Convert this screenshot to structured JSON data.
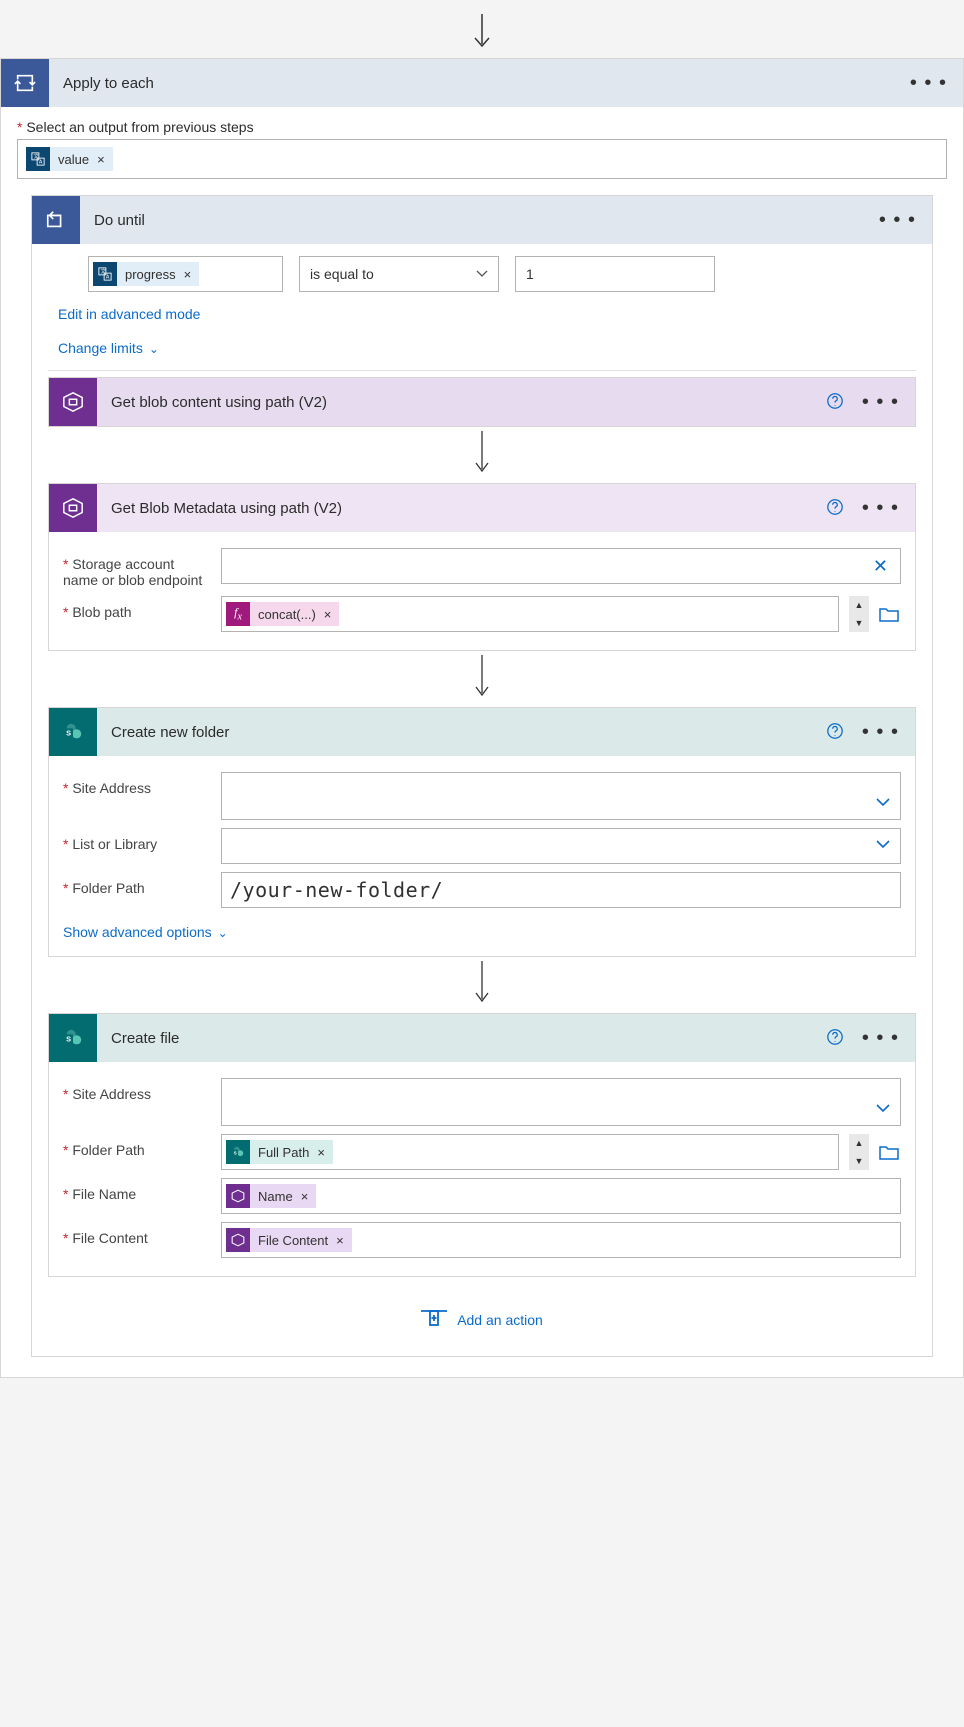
{
  "apply_each": {
    "title": "Apply to each",
    "output_label": "Select an output from previous steps",
    "value_token": "value"
  },
  "do_until": {
    "title": "Do until",
    "progress_token": "progress",
    "operator": "is equal to",
    "value": "1",
    "edit_link": "Edit in advanced mode",
    "limits_link": "Change limits"
  },
  "blob_content": {
    "title": "Get blob content using path (V2)"
  },
  "blob_meta": {
    "title": "Get Blob Metadata using path (V2)",
    "storage_label": "Storage account name or blob endpoint",
    "path_label": "Blob path",
    "concat_token": "concat(...)"
  },
  "new_folder": {
    "title": "Create new folder",
    "site_label": "Site Address",
    "list_label": "List or Library",
    "folder_label": "Folder Path",
    "folder_value": "/your-new-folder/",
    "adv_link": "Show advanced options"
  },
  "create_file": {
    "title": "Create file",
    "site_label": "Site Address",
    "folder_label": "Folder Path",
    "folder_token": "Full Path",
    "name_label": "File Name",
    "name_token": "Name",
    "content_label": "File Content",
    "content_token": "File Content"
  },
  "add_action": "Add an action"
}
